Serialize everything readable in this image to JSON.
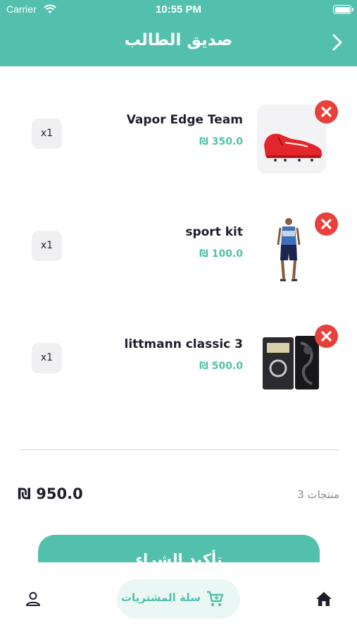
{
  "status_bar": {
    "carrier": "Carrier",
    "time": "10:55 PM"
  },
  "header": {
    "title": "صديق الطالب"
  },
  "cart": {
    "items": [
      {
        "name": "Vapor Edge Team",
        "price": "₪ 350.0",
        "quantity": "x1"
      },
      {
        "name": "sport kit",
        "price": "₪ 100.0",
        "quantity": "x1"
      },
      {
        "name": "littmann classic 3",
        "price": "₪ 500.0",
        "quantity": "x1"
      }
    ],
    "total": "₪ 950.0",
    "items_count": "3 منتجات",
    "confirm_label": "تأكيد الشراء"
  },
  "tab_bar": {
    "cart_label": "سلة المشتريات"
  },
  "colors": {
    "accent": "#52c0ac",
    "remove": "#e8413b"
  }
}
